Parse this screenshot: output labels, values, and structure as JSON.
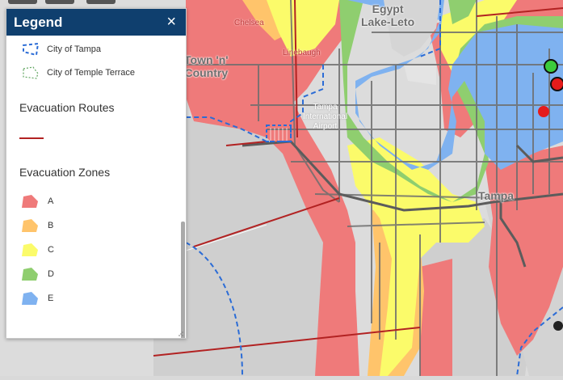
{
  "map": {
    "labels": {
      "egypt_lake_leto": "Egypt\nLake-Leto",
      "town_n_country": "Town 'n'\nCountry",
      "tampa_international_airport": "Tampa\nInternational\nAirport",
      "tampa": "Tampa",
      "upper_tampa_road": "Linebaugh",
      "chelsea": "Chelsea"
    },
    "markers": [
      {
        "name": "green-marker",
        "color": "#3ccc3c"
      },
      {
        "name": "red-marker-1",
        "color": "#e51b1b"
      },
      {
        "name": "red-marker-2",
        "color": "#e51b1b"
      }
    ]
  },
  "legend": {
    "title": "Legend",
    "close_icon": "×",
    "boundaries": [
      {
        "label": "City of Tampa",
        "icon": "tampa-boundary-icon",
        "color": "#2b6cd6"
      },
      {
        "label": "City of Temple Terrace",
        "icon": "temple-terrace-boundary-icon",
        "color": "#5ea45e"
      }
    ],
    "routes_title": "Evacuation Routes",
    "route_color": "#b22222",
    "zones_title": "Evacuation Zones",
    "zones": [
      {
        "label": "A",
        "color": "#ef7a7a"
      },
      {
        "label": "B",
        "color": "#ffc46b"
      },
      {
        "label": "C",
        "color": "#fbfb6a"
      },
      {
        "label": "D",
        "color": "#8fce6f"
      },
      {
        "label": "E",
        "color": "#7fb2f0"
      }
    ]
  }
}
